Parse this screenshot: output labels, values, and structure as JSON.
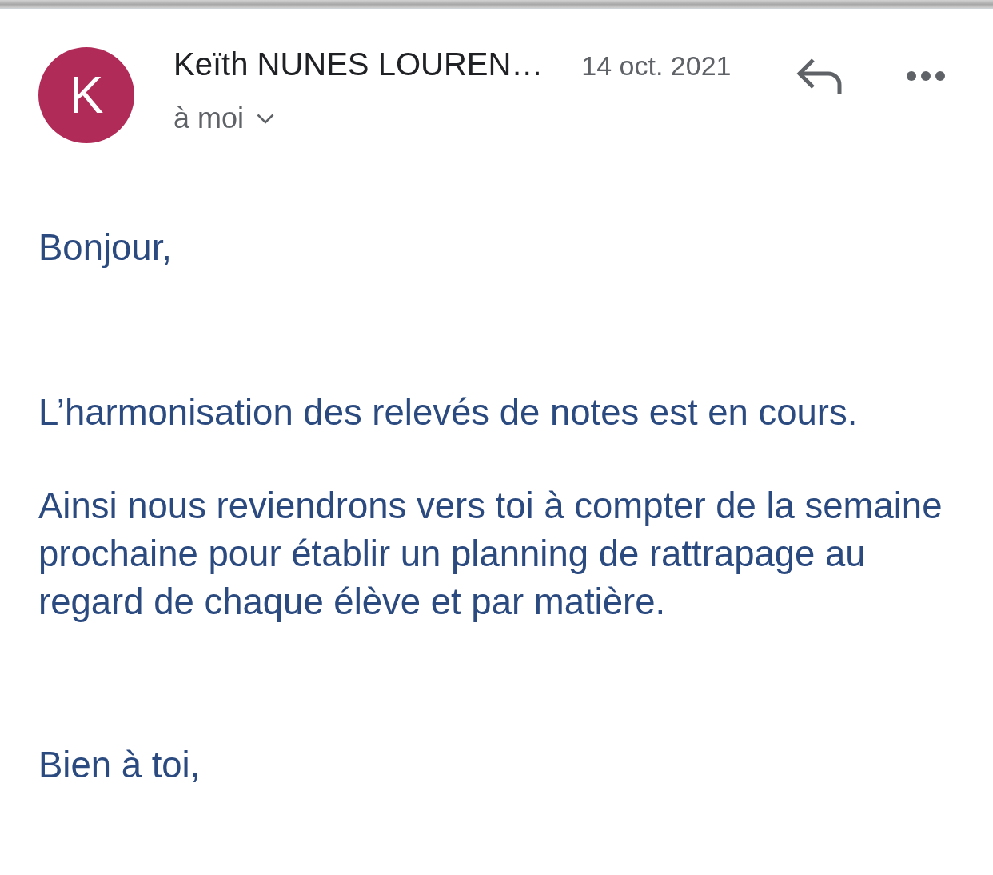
{
  "message": {
    "sender": {
      "initial": "K",
      "name": "Keïth NUNES LOUREN…"
    },
    "date": "14 oct. 2021",
    "recipient": "à moi"
  },
  "body": [
    "Bonjour,",
    "L’harmonisation des relevés de notes est en cours.",
    "Ainsi nous reviendrons vers toi à compter de la semaine prochaine pour établir un planning de rattrapage au regard de chaque élève et par matière.",
    "Bien à toi,"
  ]
}
